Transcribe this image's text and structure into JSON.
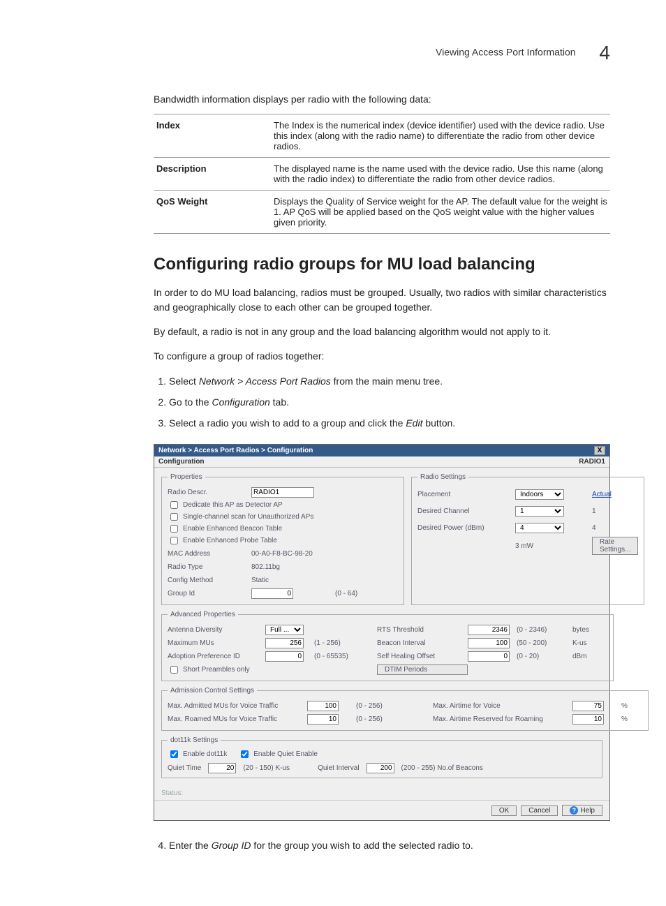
{
  "header": {
    "title": "Viewing Access Port Information",
    "chapter": "4"
  },
  "intro": "Bandwidth information displays per radio with the following data:",
  "defs": [
    {
      "term": "Index",
      "desc": "The Index is the numerical index (device identifier) used with the device radio. Use this index (along with the radio name) to differentiate the radio from other device radios."
    },
    {
      "term": "Description",
      "desc": "The displayed name is the name used with the device radio. Use this name (along with the radio index) to differentiate the radio from other device radios."
    },
    {
      "term": "QoS Weight",
      "desc": "Displays the Quality of Service weight for the AP. The default value for the weight is 1. AP QoS will be applied based on the QoS weight value with the higher values given priority."
    }
  ],
  "section_title": "Configuring radio groups for MU load balancing",
  "para1": "In order to do MU load balancing, radios must be grouped. Usually, two radios with similar characteristics and geographically close to each other can be grouped together.",
  "para2": "By default, a radio is not in any group and the load balancing algorithm would not apply to it.",
  "para3": "To configure a group of radios together:",
  "steps": [
    {
      "pre": "Select ",
      "em": "Network > Access Port Radios",
      "post": " from the main menu tree."
    },
    {
      "pre": "Go to the ",
      "em": "Configuration",
      "post": " tab."
    },
    {
      "pre": "Select a radio you wish to add to a group and click the ",
      "em": "Edit",
      "post": " button."
    }
  ],
  "step4": {
    "pre": "Enter the ",
    "em": "Group ID",
    "post": " for the group you wish to add the selected radio to."
  },
  "dlg": {
    "title": "Network > Access Port Radios > Configuration",
    "close": "X",
    "tab": "Configuration",
    "radio_label": "RADIO1",
    "props_legend": "Properties",
    "radio_descr_lbl": "Radio Descr.",
    "radio_descr_val": "RADIO1",
    "ck_detector": "Dedicate this AP as Detector AP",
    "ck_single": "Single-channel scan for Unauthorized APs",
    "ck_beacon": "Enable Enhanced Beacon Table",
    "ck_probe": "Enable Enhanced Probe Table",
    "mac_lbl": "MAC Address",
    "mac_val": "00-A0-F8-BC-98-20",
    "rtype_lbl": "Radio Type",
    "rtype_val": "802.11bg",
    "cfg_lbl": "Config Method",
    "cfg_val": "Static",
    "grp_lbl": "Group Id",
    "grp_val": "0",
    "grp_range": "(0 - 64)",
    "rs_legend": "Radio Settings",
    "placement_lbl": "Placement",
    "placement_val": "Indoors",
    "actual": "Actual",
    "chan_lbl": "Desired Channel",
    "chan_val": "1",
    "chan_act": "1",
    "pow_lbl": "Desired Power (dBm)",
    "pow_val": "4",
    "pow_act": "4",
    "mw": "3 mW",
    "rate_btn": "Rate Settings...",
    "adv_legend": "Advanced Properties",
    "ant_lbl": "Antenna Diversity",
    "ant_val": "Full ...",
    "max_lbl": "Maximum MUs",
    "max_val": "256",
    "max_rng": "(1 - 256)",
    "adopt_lbl": "Adoption Preference ID",
    "adopt_val": "0",
    "adopt_rng": "(0 - 65535)",
    "short_lbl": "Short Preambles only",
    "rts_lbl": "RTS Threshold",
    "rts_val": "2346",
    "rts_rng": "(0 - 2346)",
    "rts_unit": "bytes",
    "bi_lbl": "Beacon Interval",
    "bi_val": "100",
    "bi_rng": "(50 - 200)",
    "bi_unit": "K-us",
    "sh_lbl": "Self Healing Offset",
    "sh_val": "0",
    "sh_rng": "(0 - 20)",
    "sh_unit": "dBm",
    "dtim_btn": "DTIM Periods",
    "ac_legend": "Admission Control Settings",
    "ac_mu_lbl": "Max. Admitted MUs for Voice Traffic",
    "ac_mu_val": "100",
    "ac_mu_rng": "(0 - 256)",
    "ac_rm_lbl": "Max. Roamed MUs for Voice Traffic",
    "ac_rm_val": "10",
    "ac_rm_rng": "(0 - 256)",
    "ac_air_lbl": "Max. Airtime for Voice",
    "ac_air_val": "75",
    "pct": "%",
    "ac_roam_lbl": "Max. Airtime Reserved for Roaming",
    "ac_roam_val": "10",
    "d11_legend": "dot11k Settings",
    "d11_en": "Enable dot11k",
    "d11_quiet": "Enable Quiet Enable",
    "qt_lbl": "Quiet Time",
    "qt_val": "20",
    "qt_rng": "(20 - 150) K-us",
    "qi_lbl": "Quiet Interval",
    "qi_val": "200",
    "qi_rng": "(200 - 255) No.of Beacons",
    "status": "Status:",
    "ok": "OK",
    "cancel": "Cancel",
    "help": "Help"
  }
}
